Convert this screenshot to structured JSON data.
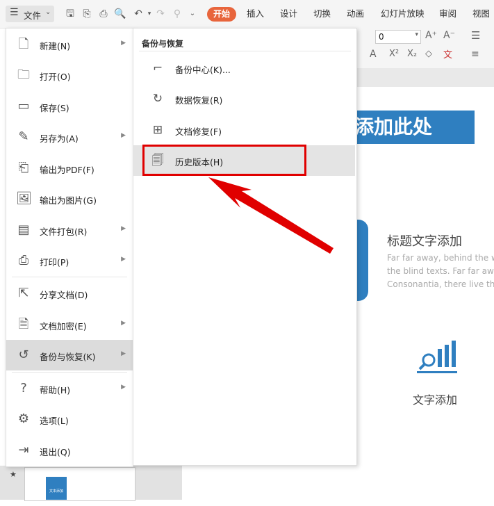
{
  "topbar": {
    "menu_label": "文件",
    "tabs": [
      "开始",
      "插入",
      "设计",
      "切换",
      "动画",
      "幻灯片放映",
      "审阅",
      "视图"
    ],
    "active_tab": "开始"
  },
  "ribbon": {
    "font_size_value": "0"
  },
  "file_menu": {
    "items": [
      {
        "label": "新建(N)",
        "icon": "new-file-icon",
        "has_submenu": true
      },
      {
        "label": "打开(O)",
        "icon": "folder-open-icon",
        "has_submenu": false
      },
      {
        "label": "保存(S)",
        "icon": "save-icon",
        "has_submenu": false
      },
      {
        "label": "另存为(A)",
        "icon": "save-as-icon",
        "has_submenu": true
      },
      {
        "label": "输出为PDF(F)",
        "icon": "export-pdf-icon",
        "has_submenu": false
      },
      {
        "label": "输出为图片(G)",
        "icon": "export-image-icon",
        "has_submenu": false
      },
      {
        "label": "文件打包(R)",
        "icon": "package-icon",
        "has_submenu": true
      },
      {
        "label": "打印(P)",
        "icon": "print-icon",
        "has_submenu": true
      },
      {
        "label": "分享文档(D)",
        "icon": "share-icon",
        "has_submenu": false
      },
      {
        "label": "文档加密(E)",
        "icon": "encrypt-icon",
        "has_submenu": true
      },
      {
        "label": "备份与恢复(K)",
        "icon": "backup-icon",
        "has_submenu": true
      },
      {
        "label": "帮助(H)",
        "icon": "help-icon",
        "has_submenu": true
      },
      {
        "label": "选项(L)",
        "icon": "settings-icon",
        "has_submenu": false
      },
      {
        "label": "退出(Q)",
        "icon": "exit-icon",
        "has_submenu": false
      }
    ],
    "active_item": "备份与恢复(K)"
  },
  "sub_menu": {
    "title": "备份与恢复",
    "items": [
      {
        "label": "备份中心(K)...",
        "icon": "backup-center-icon"
      },
      {
        "label": "数据恢复(R)",
        "icon": "data-recovery-icon"
      },
      {
        "label": "文档修复(F)",
        "icon": "document-repair-icon"
      },
      {
        "label": "历史版本(H)",
        "icon": "history-version-icon"
      }
    ],
    "highlighted_item": "历史版本(H)"
  },
  "slide": {
    "title_fragment": "添加此处",
    "heading": "标题文字添加",
    "lorem_lines": [
      "Far far away, behind the w",
      "the blind texts. Far far awa",
      "Consonantia, there live the"
    ],
    "caption": "文字添加"
  },
  "thumbnail": {
    "label": "文本添加"
  },
  "colors": {
    "accent_orange": "#e8653c",
    "slide_blue": "#2f7fc0",
    "highlight_red": "#e00000"
  }
}
